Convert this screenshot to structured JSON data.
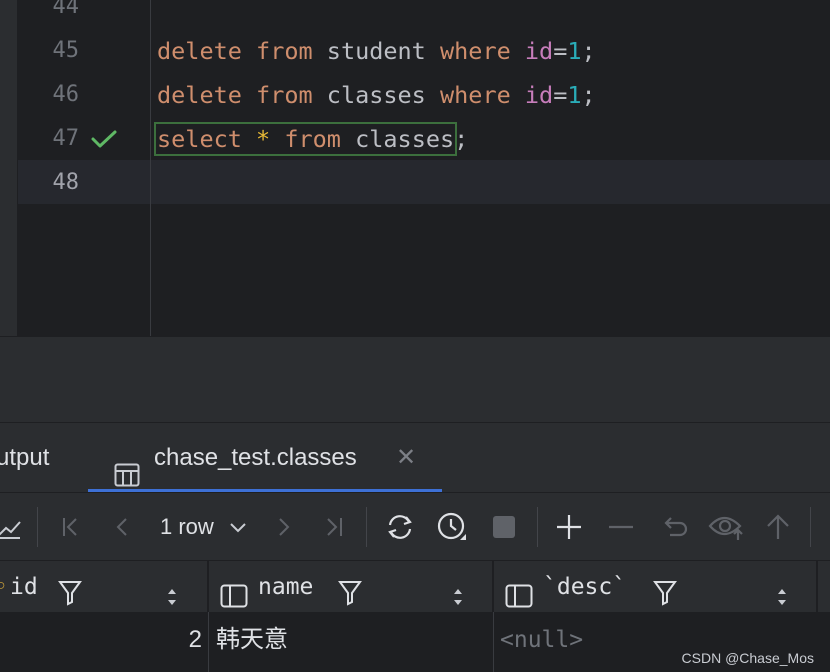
{
  "editor": {
    "lines": [
      {
        "num": "44",
        "code": ""
      },
      {
        "num": "45",
        "code": "delete from student where id=1;"
      },
      {
        "num": "46",
        "code": "delete from classes where id=1;"
      },
      {
        "num": "47",
        "code": "select * from classes;"
      },
      {
        "num": "48",
        "code": ""
      }
    ],
    "tokens": {
      "delete": "delete",
      "from": "from",
      "where": "where",
      "select": "select",
      "student": "student",
      "classes": "classes",
      "id": "id",
      "eq": "=",
      "one": "1",
      "semi": ";",
      "star": "*"
    },
    "executed_line_status": "check-icon",
    "colors": {
      "keyword": "#cf8e6d",
      "column": "#c77dbb",
      "number": "#2aacb8",
      "success": "#5fb865"
    }
  },
  "tabs": {
    "output_label": "utput",
    "result_label": "chase_test.classes",
    "active_tab": "chase_test.classes",
    "accent": "#3d70d6"
  },
  "toolbar": {
    "rows_label": "1 row",
    "icons": [
      "chart-icon",
      "first-page-icon",
      "prev-page-icon",
      "next-page-icon",
      "last-page-icon",
      "refresh-icon",
      "history-icon",
      "stop-icon",
      "add-row-icon",
      "delete-row-icon",
      "revert-icon",
      "preview-icon",
      "submit-icon"
    ]
  },
  "grid": {
    "columns": [
      {
        "name": "id"
      },
      {
        "name": "name"
      },
      {
        "name": "`desc`"
      }
    ],
    "rows": [
      {
        "id": "2",
        "name": "韩天意",
        "desc": "<null>"
      }
    ]
  },
  "watermark": "CSDN @Chase_Mos"
}
